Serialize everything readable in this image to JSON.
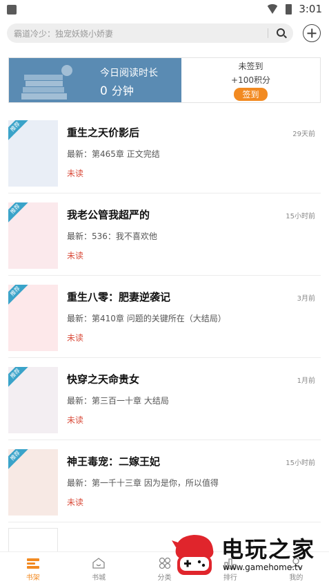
{
  "status_bar": {
    "time": "3:01"
  },
  "search": {
    "placeholder": "霸道冷少：独宠妖娆小娇妻"
  },
  "banner": {
    "read_time_title": "今日阅读时长",
    "read_time_value": "0",
    "read_time_unit": "分钟",
    "sign_status": "未签到",
    "sign_reward": "+100积分",
    "sign_button": "签到"
  },
  "books": [
    {
      "title": "重生之天价影后",
      "time": "29天前",
      "latest": "最新：第465章 正文完结",
      "status": "未读",
      "tag": "推荐",
      "cover_color": "#e9eef6"
    },
    {
      "title": "我老公管我超严的",
      "time": "15小时前",
      "latest": "最新：536：我不喜欢他",
      "status": "未读",
      "tag": "推荐",
      "cover_color": "#fbe9ec"
    },
    {
      "title": "重生八零：肥妻逆袭记",
      "time": "3月前",
      "latest": "最新：第410章 问题的关键所在（大结局）",
      "status": "未读",
      "tag": "推荐",
      "cover_color": "#fde8ea"
    },
    {
      "title": "快穿之天命贵女",
      "time": "1月前",
      "latest": "最新：第三百一十章 大结局",
      "status": "未读",
      "tag": "推荐",
      "cover_color": "#f3eef2"
    },
    {
      "title": "神王毒宠：二嫁王妃",
      "time": "15小时前",
      "latest": "最新：第一千十三章 因为是你，所以值得",
      "status": "未读",
      "tag": "推荐",
      "cover_color": "#f7e9e4"
    }
  ],
  "bottom_nav": [
    {
      "label": "书架",
      "icon": "bookshelf-icon",
      "active": true
    },
    {
      "label": "书城",
      "icon": "bookstore-icon",
      "active": false
    },
    {
      "label": "分类",
      "icon": "category-icon",
      "active": false
    },
    {
      "label": "排行",
      "icon": "ranking-icon",
      "active": false
    },
    {
      "label": "我的",
      "icon": "profile-icon",
      "active": false
    }
  ],
  "watermark": {
    "title": "电玩之家",
    "url": "www.gamehome.tv"
  },
  "colors": {
    "accent": "#f28a21",
    "banner_blue": "#5a8bb3",
    "unread_red": "#d94b3a",
    "tag_blue": "#3aa3c9"
  }
}
